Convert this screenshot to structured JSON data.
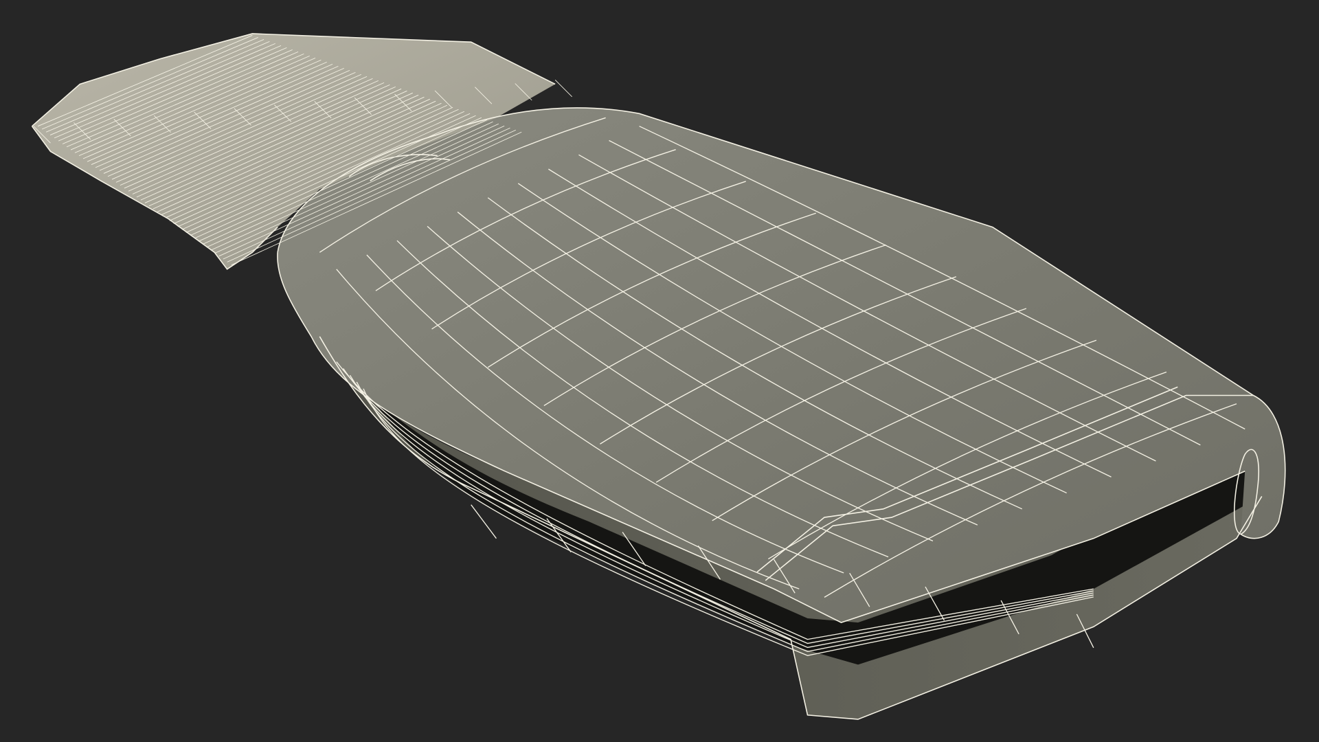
{
  "scene": {
    "subject": "wireframe-3d-model",
    "background_color": "#262626",
    "surface_color": "#7a7a70",
    "surface_dark_color": "#5e5e55",
    "shadow_color": "#141412",
    "wire_color": "#f4f1e4"
  }
}
